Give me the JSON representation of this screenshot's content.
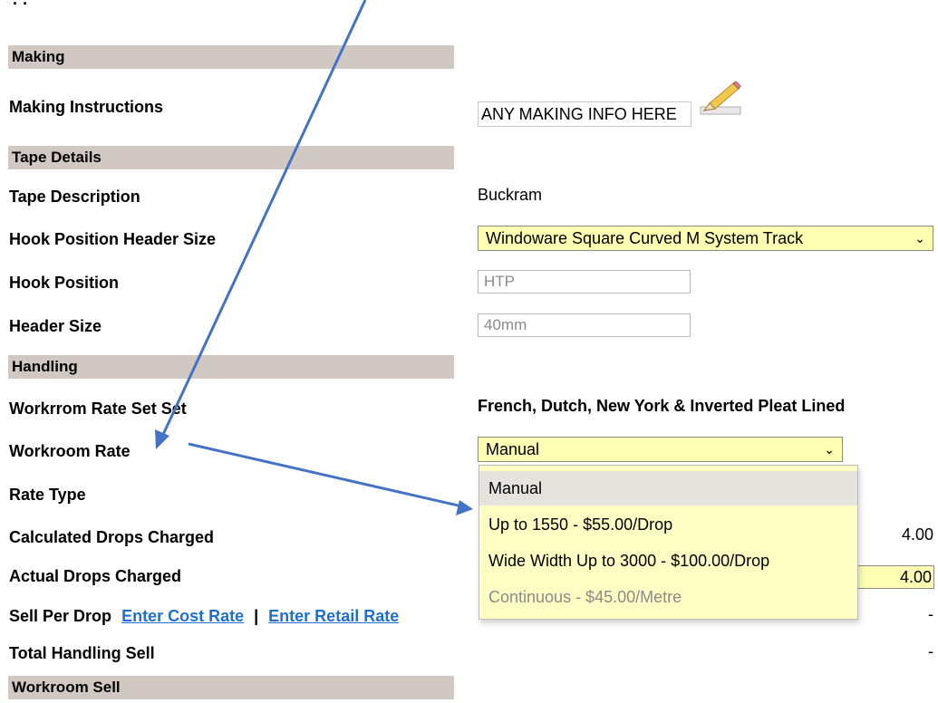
{
  "clipped_text": "· ·",
  "sections": {
    "making": "Making",
    "tape_details": "Tape Details",
    "handling": "Handling",
    "workroom_sell": "Workroom Sell"
  },
  "making": {
    "instructions_label": "Making Instructions",
    "instructions_value": "ANY MAKING INFO HERE"
  },
  "tape": {
    "description_label": "Tape Description",
    "description_value": "Buckram",
    "hook_header_label": "Hook Position Header Size",
    "hook_header_selected": "Windoware Square Curved M System Track",
    "hook_position_label": "Hook Position",
    "hook_position_value": "HTP",
    "header_size_label": "Header Size",
    "header_size_value": "40mm"
  },
  "handling": {
    "rate_set_label": "Workrrom Rate Set Set",
    "rate_set_value": "French, Dutch, New York & Inverted Pleat Lined",
    "workroom_rate_label": "Workroom Rate",
    "workroom_rate_selected": "Manual",
    "rate_type_label": "Rate Type",
    "calc_drops_label": "Calculated Drops Charged",
    "calc_drops_value": "4.00",
    "actual_drops_label": "Actual Drops Charged",
    "actual_drops_value": "4.00",
    "sell_per_drop_label": "Sell Per Drop",
    "enter_cost_rate": "Enter Cost Rate",
    "separator": "|",
    "enter_retail_rate": "Enter Retail Rate",
    "sell_per_drop_value": "-",
    "total_handling_label": "Total Handling Sell",
    "total_handling_value": "-"
  },
  "dropdown_options": [
    "Manual",
    "Up to 1550 - $55.00/Drop",
    "Wide Width Up to 3000 - $100.00/Drop",
    "Continuous - $45.00/Metre"
  ],
  "colors": {
    "section_bg": "#d2c8c3",
    "select_bg": "#ffffb4",
    "link": "#1f6fd1",
    "arrow": "#4472c4"
  }
}
